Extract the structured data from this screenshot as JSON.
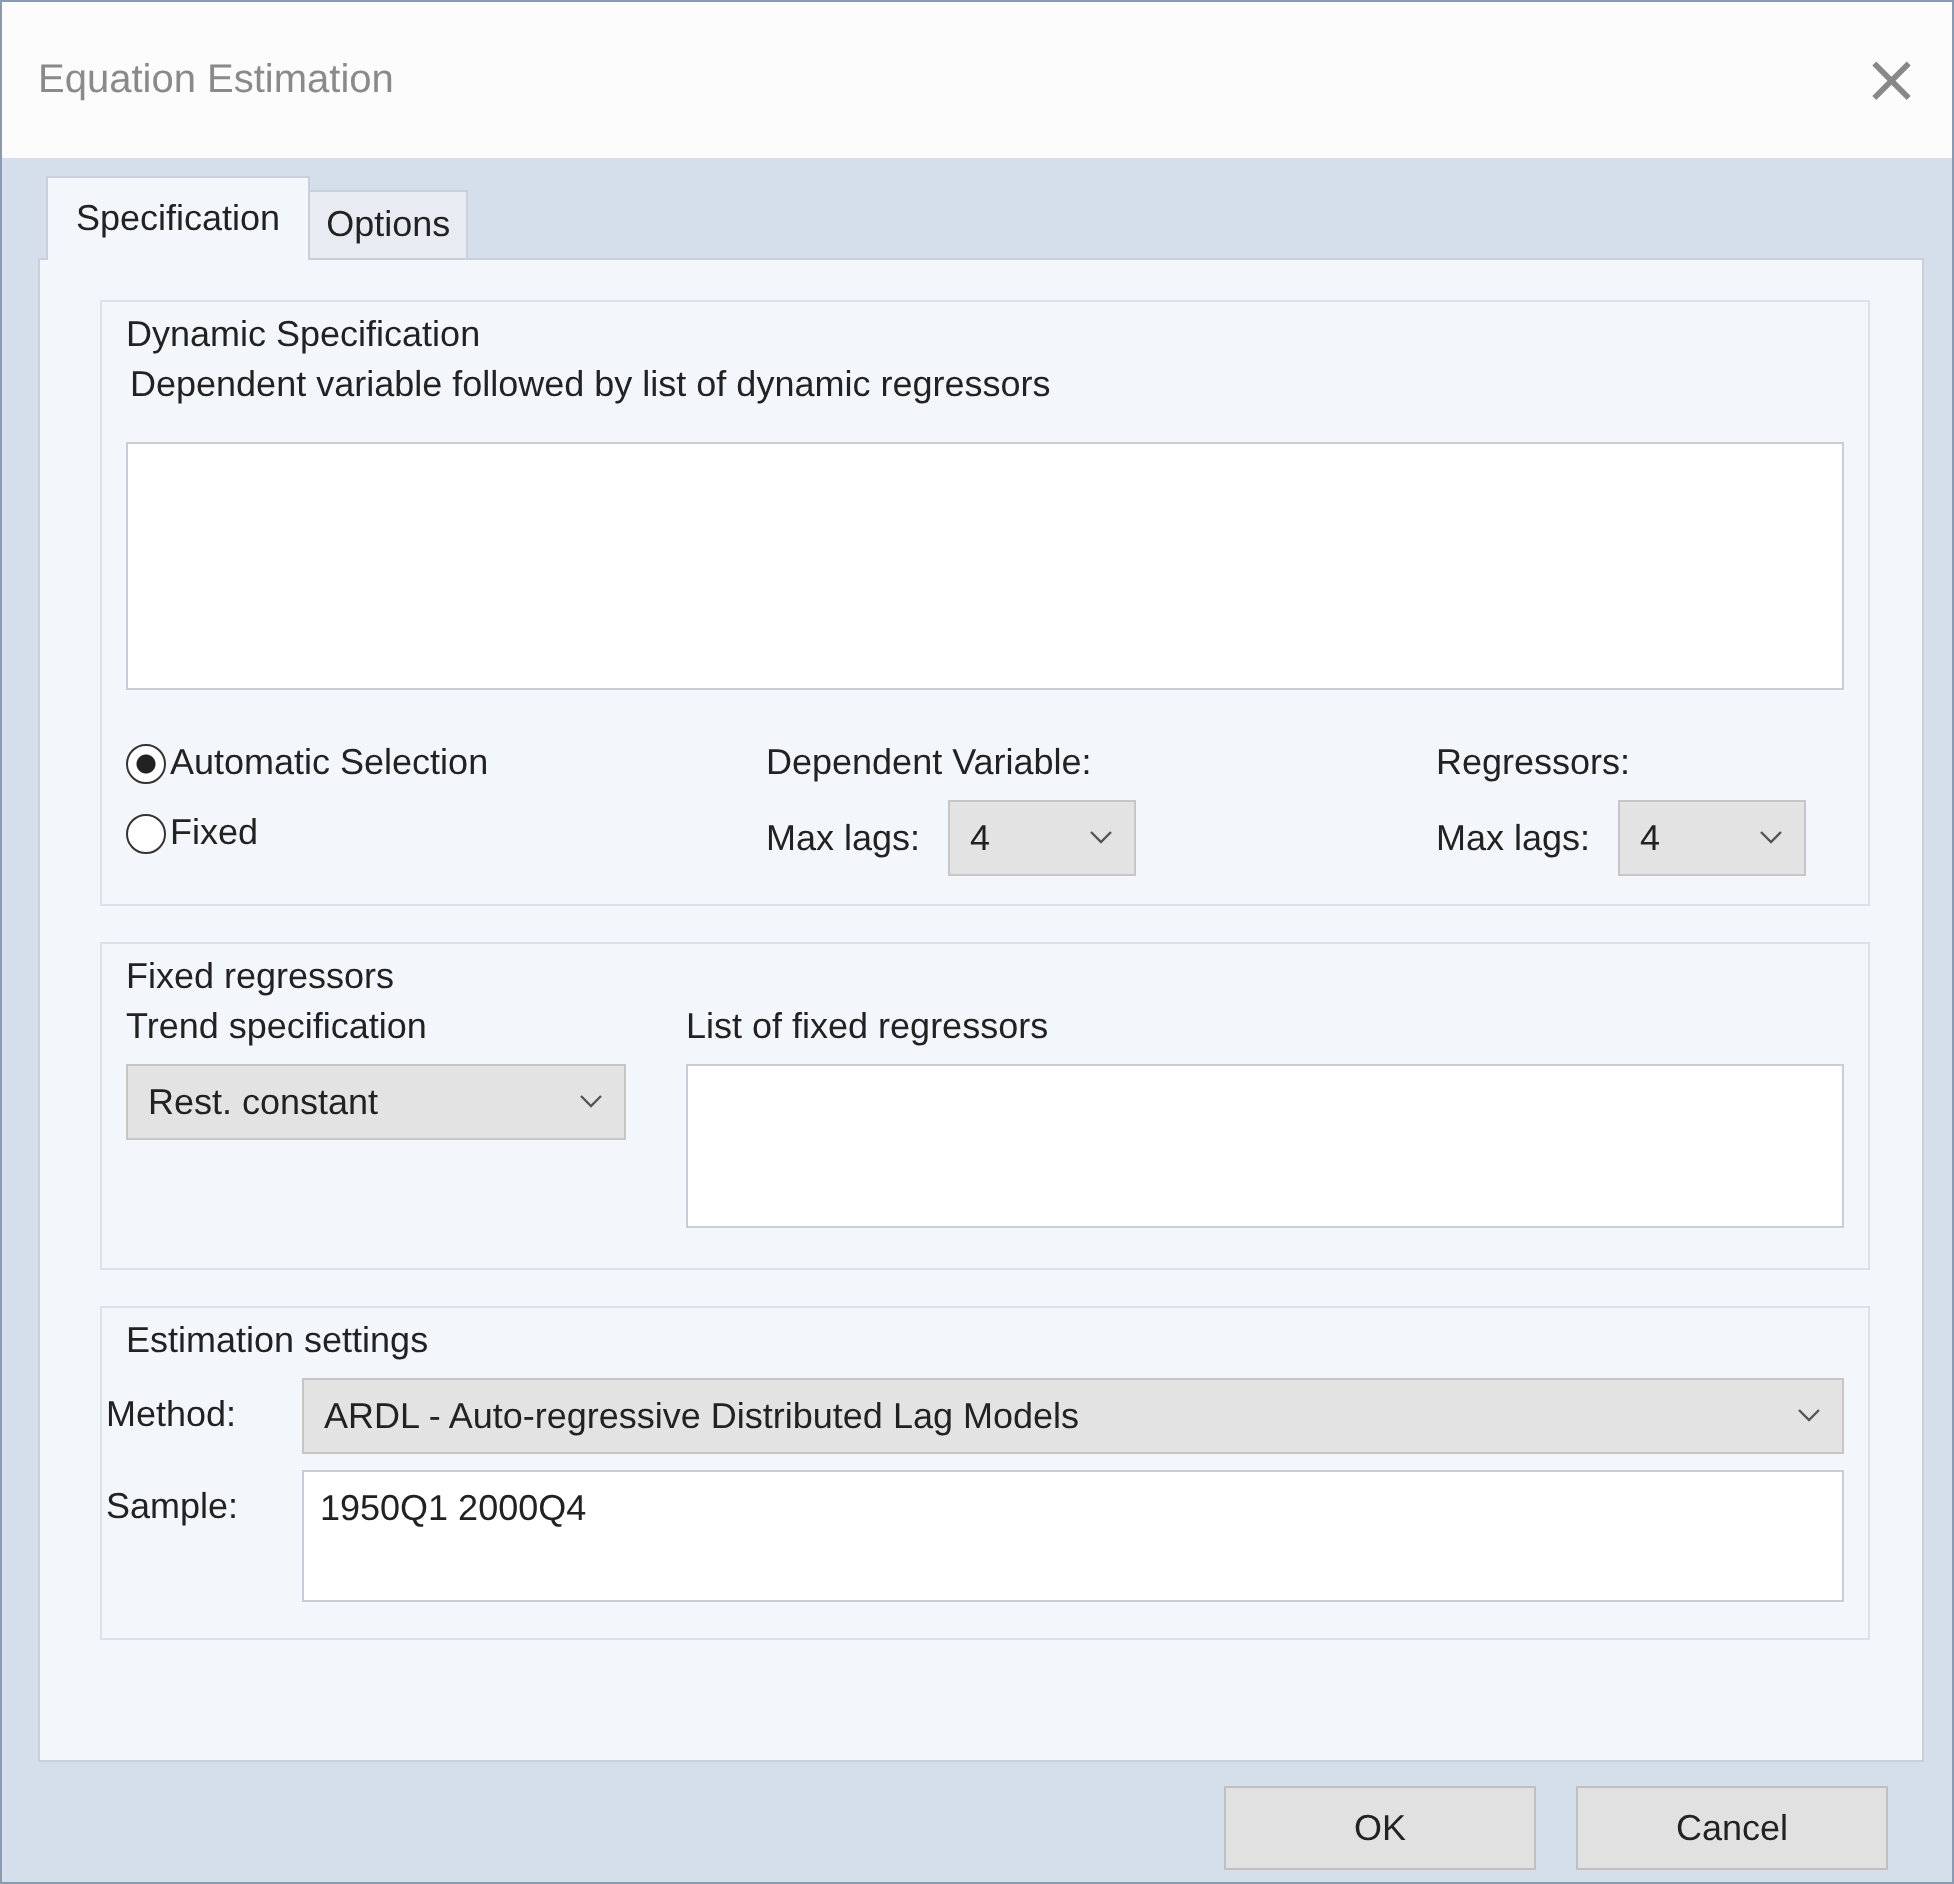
{
  "window": {
    "title": "Equation Estimation",
    "close": "×"
  },
  "tabs": [
    {
      "label": "Specification",
      "selected": true
    },
    {
      "label": "Options",
      "selected": false
    }
  ],
  "dynamic": {
    "title": "Dynamic Specification",
    "list_label": "Dependent variable followed by list of dynamic regressors",
    "selection": [
      {
        "label": "Automatic Selection",
        "selected": true
      },
      {
        "label": "Fixed",
        "selected": false
      }
    ],
    "dependent": {
      "title": "Dependent Variable:",
      "lags_label": "Max lags:",
      "lags": "4"
    },
    "regressors": {
      "title": "Regressors:",
      "lags_label": "Max lags:",
      "lags": "4"
    }
  },
  "fixed": {
    "title": "Fixed regressors",
    "trend_label": "Trend specification",
    "trend": "Rest. constant",
    "list_label": "List of fixed regressors"
  },
  "estimation": {
    "title": "Estimation settings",
    "method_label": "Method:",
    "method": "ARDL - Auto-regressive Distributed Lag Models",
    "sample_label": "Sample:",
    "sample": "1950Q1 2000Q4"
  },
  "buttons": [
    "OK",
    "Cancel"
  ]
}
